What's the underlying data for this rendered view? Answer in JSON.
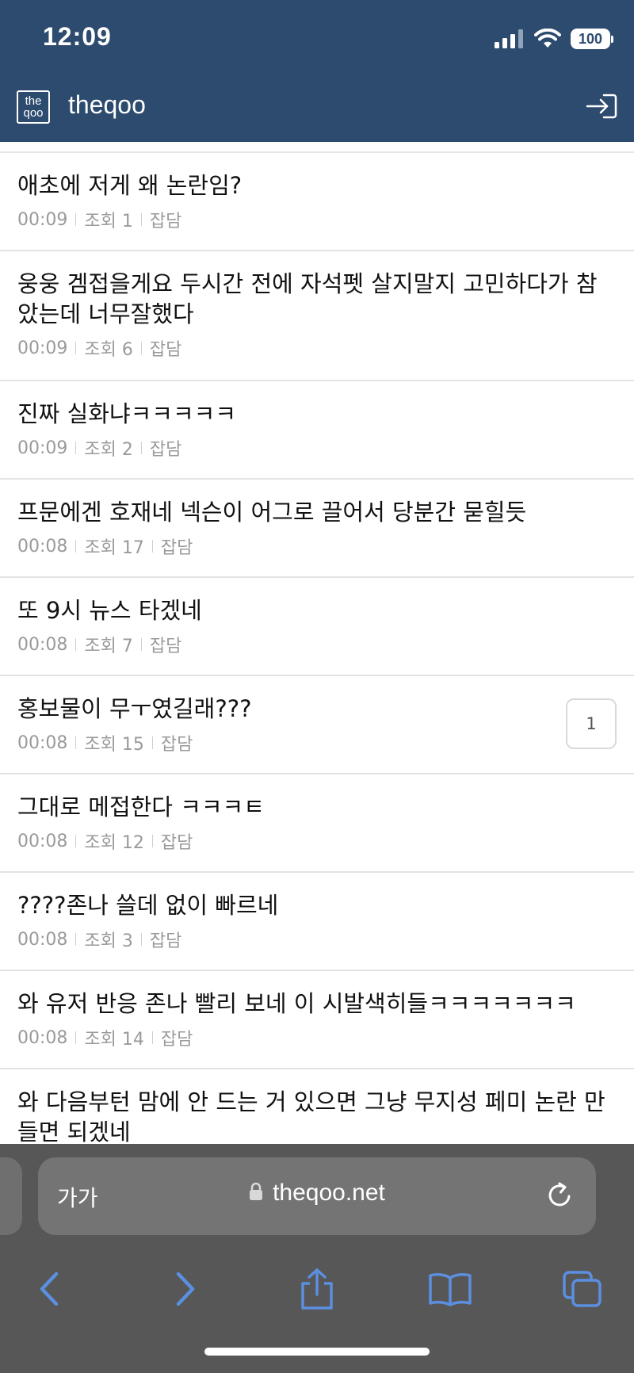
{
  "status": {
    "time": "12:09",
    "battery": "100"
  },
  "header": {
    "logo_top": "the",
    "logo_bottom": "qoo",
    "brand": "theqoo"
  },
  "posts": [
    {
      "title": "애초에 저게 왜 논란임?",
      "time": "00:09",
      "views": "조회 1",
      "category": "잡담"
    },
    {
      "title": "웅웅 겜접을게요 두시간 전에 자석펫 살지말지 고민하다가 참았는데 너무잘했다",
      "time": "00:09",
      "views": "조회 6",
      "category": "잡담"
    },
    {
      "title": "진짜 실화냐ㅋㅋㅋㅋㅋ",
      "time": "00:09",
      "views": "조회 2",
      "category": "잡담"
    },
    {
      "title": "프문에겐 호재네 넥슨이 어그로 끌어서 당분간 묻힐듯",
      "time": "00:08",
      "views": "조회 17",
      "category": "잡담"
    },
    {
      "title": "또 9시 뉴스 타겠네",
      "time": "00:08",
      "views": "조회 7",
      "category": "잡담"
    },
    {
      "title": "홍보물이 무ㅜ였길래???",
      "time": "00:08",
      "views": "조회 15",
      "category": "잡담",
      "replies": "1"
    },
    {
      "title": "그대로 메접한다 ㅋㅋㅋㅌ",
      "time": "00:08",
      "views": "조회 12",
      "category": "잡담"
    },
    {
      "title": "????존나 쓸데 없이 빠르네",
      "time": "00:08",
      "views": "조회 3",
      "category": "잡담"
    },
    {
      "title": "와 유저 반응 존나 빨리 보네 이 시발색히들ㅋㅋㅋㅋㅋㅋㅋ",
      "time": "00:08",
      "views": "조회 14",
      "category": "잡담"
    },
    {
      "title": "와 다음부턴 맘에 안 드는 거 있으면 그냥 무지성 페미 논란 만들면 되겠네"
    }
  ],
  "browser": {
    "text_size_label": "가가",
    "url": "theqoo.net"
  },
  "colors": {
    "header_bg": "#2c4b6e",
    "toolbar_bg": "#575757",
    "icon_blue": "#5b8fe0"
  }
}
